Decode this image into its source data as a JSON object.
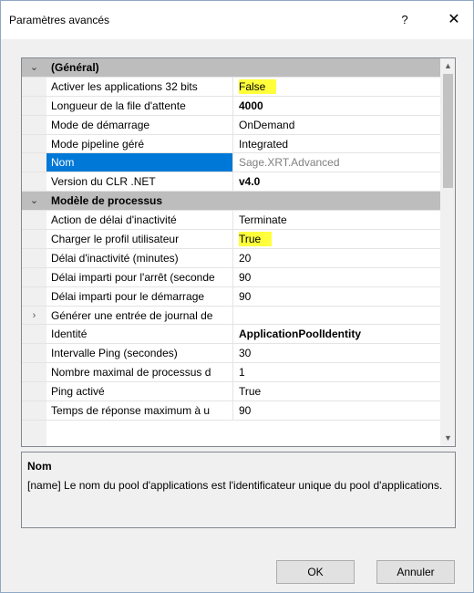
{
  "window": {
    "title": "Paramètres avancés",
    "help_glyph": "?",
    "close_glyph": "✕"
  },
  "grid": {
    "expand_glyph": "⌄",
    "collapsed_glyph": "›",
    "rows": [
      {
        "type": "category",
        "name": "(Général)",
        "glyph": "⌄"
      },
      {
        "type": "prop",
        "name": "Activer les applications 32 bits",
        "value": "False",
        "highlight": true
      },
      {
        "type": "prop",
        "name": "Longueur de la file d'attente",
        "value": "4000",
        "bold": true
      },
      {
        "type": "prop",
        "name": "Mode de démarrage",
        "value": "OnDemand"
      },
      {
        "type": "prop",
        "name": "Mode pipeline géré",
        "value": "Integrated"
      },
      {
        "type": "prop",
        "name": "Nom",
        "value": "Sage.XRT.Advanced",
        "selected": true
      },
      {
        "type": "prop",
        "name": "Version du CLR .NET",
        "value": "v4.0",
        "bold": true
      },
      {
        "type": "category",
        "name": "Modèle de processus",
        "glyph": "⌄"
      },
      {
        "type": "prop",
        "name": "Action de délai d'inactivité",
        "value": "Terminate"
      },
      {
        "type": "prop",
        "name": "Charger le profil utilisateur",
        "value": "True",
        "highlight": true
      },
      {
        "type": "prop",
        "name": "Délai d'inactivité (minutes)",
        "value": "20"
      },
      {
        "type": "prop",
        "name": "Délai imparti pour l'arrêt (seconde",
        "value": "90"
      },
      {
        "type": "prop",
        "name": "Délai imparti pour le démarrage",
        "value": "90"
      },
      {
        "type": "prop",
        "name": "Générer une entrée de journal de",
        "value": "",
        "glyph": "›"
      },
      {
        "type": "prop",
        "name": "Identité",
        "value": "ApplicationPoolIdentity",
        "bold": true
      },
      {
        "type": "prop",
        "name": "Intervalle Ping (secondes)",
        "value": "30"
      },
      {
        "type": "prop",
        "name": "Nombre maximal de processus d",
        "value": "1"
      },
      {
        "type": "prop",
        "name": "Ping activé",
        "value": "True"
      },
      {
        "type": "prop",
        "name": "Temps de réponse maximum à u",
        "value": "90"
      }
    ],
    "scroll_up_glyph": "▲",
    "scroll_down_glyph": "▼"
  },
  "description": {
    "title": "Nom",
    "text": "[name] Le nom du pool d'applications est l'identificateur unique du pool d'applications."
  },
  "buttons": {
    "ok_label": "OK",
    "cancel_label": "Annuler"
  },
  "colors": {
    "selection": "#0078d7",
    "category_background": "#bdbdbd",
    "highlight": "#ffff3c"
  }
}
